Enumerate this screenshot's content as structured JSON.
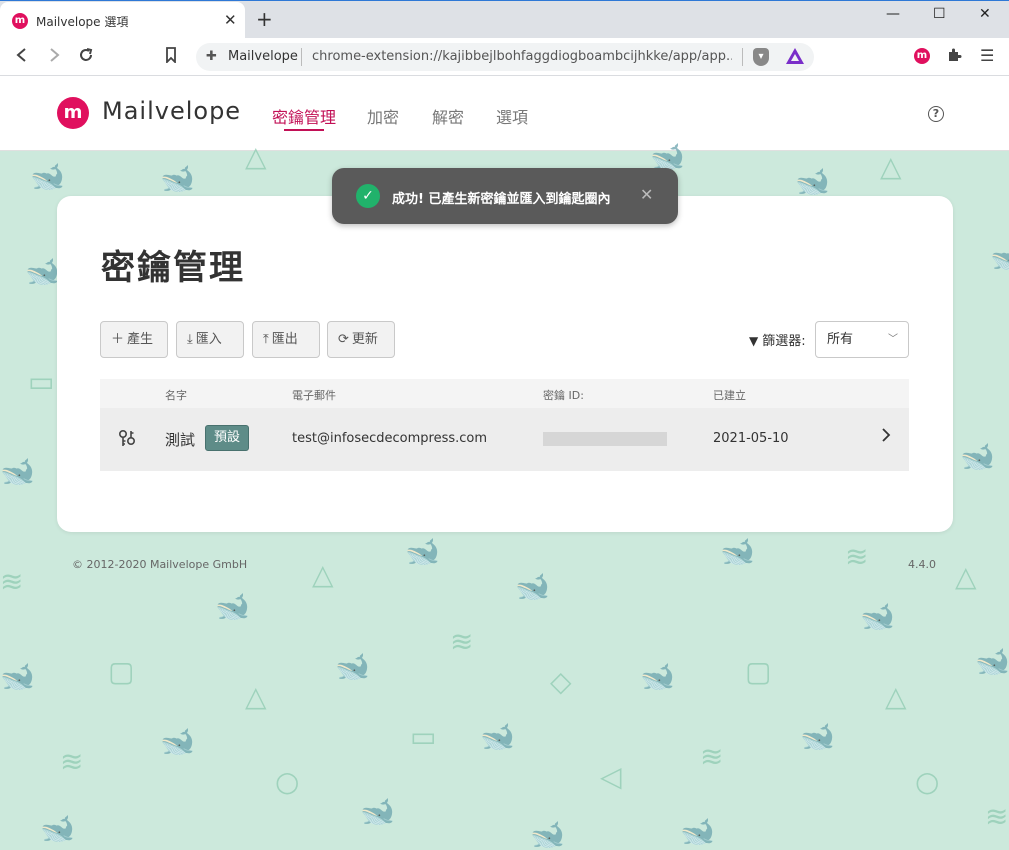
{
  "browser": {
    "tab_title": "Mailvelope 選項",
    "tab_close": "✕",
    "new_tab": "+",
    "window_controls": {
      "minimize": "—",
      "maximize": "☐",
      "close": "✕"
    },
    "omnibox": {
      "site_label": "Mailvelope",
      "url": "chrome-extension://kajibbejlbohfaggdiogboambcijhkke/app/app...."
    }
  },
  "app": {
    "logo_text": "Mailvelope",
    "nav": [
      "密鑰管理",
      "加密",
      "解密",
      "選項"
    ],
    "active_nav_index": 0,
    "brand_color": "#c21056"
  },
  "toast": {
    "message": "成功! 已產生新密鑰並匯入到鑰匙圈內",
    "type": "success"
  },
  "page": {
    "title": "密鑰管理",
    "buttons": {
      "generate": "產生",
      "import": "匯入",
      "export": "匯出",
      "refresh": "更新"
    },
    "filter": {
      "label": "篩選器:",
      "value": "所有"
    },
    "table": {
      "headers": [
        "名字",
        "電子郵件",
        "密鑰 ID:",
        "已建立"
      ],
      "rows": [
        {
          "name": "測試",
          "badge": "預設",
          "email": "test@infosecdecompress.com",
          "key_id": "",
          "created": "2021-05-10"
        }
      ]
    }
  },
  "footer": {
    "copyright": "© 2012-2020  Mailvelope GmbH",
    "version": "4.4.0"
  }
}
